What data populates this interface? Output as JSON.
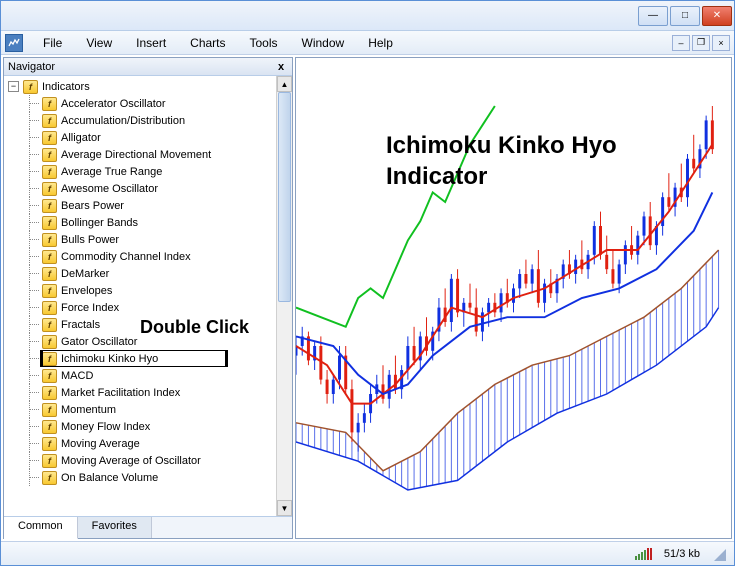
{
  "window": {
    "titlebar": {
      "minimize": "—",
      "maximize": "□",
      "close": "✕"
    }
  },
  "menubar": {
    "items": [
      "File",
      "View",
      "Insert",
      "Charts",
      "Tools",
      "Window",
      "Help"
    ],
    "child_min": "–",
    "child_restore": "❐",
    "child_close": "×"
  },
  "navigator": {
    "title": "Navigator",
    "close_glyph": "x",
    "root_label": "Indicators",
    "expand_glyph": "−",
    "icon_glyph": "f",
    "items": [
      "Accelerator Oscillator",
      "Accumulation/Distribution",
      "Alligator",
      "Average Directional Movement",
      "Average True Range",
      "Awesome Oscillator",
      "Bears Power",
      "Bollinger Bands",
      "Bulls Power",
      "Commodity Channel Index",
      "DeMarker",
      "Envelopes",
      "Force Index",
      "Fractals",
      "Gator Oscillator",
      "Ichimoku Kinko Hyo",
      "MACD",
      "Market Facilitation Index",
      "Momentum",
      "Money Flow Index",
      "Moving Average",
      "Moving Average of Oscillator",
      "On Balance Volume"
    ],
    "highlighted_index": 15,
    "tabs": {
      "common": "Common",
      "favorites": "Favorites"
    },
    "scroll": {
      "up": "▲",
      "down": "▼"
    }
  },
  "annotations": {
    "title_line1": "Ichimoku Kinko Hyo",
    "title_line2": "Indicator",
    "double_click": "Double Click"
  },
  "statusbar": {
    "transfer": "51/3 kb"
  },
  "chart_data": {
    "type": "candlestick-with-indicator",
    "indicator": "Ichimoku Kinko Hyo",
    "colors": {
      "up_candle": "#1030e0",
      "down_candle": "#e02010",
      "tenkan": "#e02010",
      "kijun": "#1030e0",
      "chikou": "#10c020",
      "span_a": "#a0522d",
      "span_b": "#1030e0",
      "cloud_hatch": "#1030e0"
    },
    "x_range": [
      0,
      70
    ],
    "y_range": [
      0,
      100
    ],
    "candles": [
      {
        "x": 0,
        "o": 38,
        "h": 42,
        "l": 34,
        "c": 40,
        "d": "u"
      },
      {
        "x": 1,
        "o": 40,
        "h": 44,
        "l": 38,
        "c": 42,
        "d": "u"
      },
      {
        "x": 2,
        "o": 42,
        "h": 43,
        "l": 36,
        "c": 37,
        "d": "d"
      },
      {
        "x": 3,
        "o": 37,
        "h": 41,
        "l": 35,
        "c": 40,
        "d": "u"
      },
      {
        "x": 4,
        "o": 40,
        "h": 42,
        "l": 32,
        "c": 33,
        "d": "d"
      },
      {
        "x": 5,
        "o": 33,
        "h": 35,
        "l": 28,
        "c": 30,
        "d": "d"
      },
      {
        "x": 6,
        "o": 30,
        "h": 34,
        "l": 28,
        "c": 33,
        "d": "u"
      },
      {
        "x": 7,
        "o": 33,
        "h": 40,
        "l": 31,
        "c": 38,
        "d": "u"
      },
      {
        "x": 8,
        "o": 38,
        "h": 40,
        "l": 30,
        "c": 31,
        "d": "d"
      },
      {
        "x": 9,
        "o": 31,
        "h": 33,
        "l": 20,
        "c": 22,
        "d": "d"
      },
      {
        "x": 10,
        "o": 22,
        "h": 26,
        "l": 18,
        "c": 24,
        "d": "u"
      },
      {
        "x": 11,
        "o": 24,
        "h": 28,
        "l": 22,
        "c": 26,
        "d": "u"
      },
      {
        "x": 12,
        "o": 26,
        "h": 32,
        "l": 24,
        "c": 30,
        "d": "u"
      },
      {
        "x": 13,
        "o": 30,
        "h": 34,
        "l": 28,
        "c": 32,
        "d": "u"
      },
      {
        "x": 14,
        "o": 32,
        "h": 36,
        "l": 28,
        "c": 29,
        "d": "d"
      },
      {
        "x": 15,
        "o": 29,
        "h": 35,
        "l": 27,
        "c": 34,
        "d": "u"
      },
      {
        "x": 16,
        "o": 34,
        "h": 38,
        "l": 30,
        "c": 31,
        "d": "d"
      },
      {
        "x": 17,
        "o": 31,
        "h": 36,
        "l": 29,
        "c": 35,
        "d": "u"
      },
      {
        "x": 18,
        "o": 35,
        "h": 42,
        "l": 33,
        "c": 40,
        "d": "u"
      },
      {
        "x": 19,
        "o": 40,
        "h": 44,
        "l": 36,
        "c": 37,
        "d": "d"
      },
      {
        "x": 20,
        "o": 37,
        "h": 43,
        "l": 35,
        "c": 42,
        "d": "u"
      },
      {
        "x": 21,
        "o": 42,
        "h": 46,
        "l": 38,
        "c": 39,
        "d": "d"
      },
      {
        "x": 22,
        "o": 39,
        "h": 44,
        "l": 37,
        "c": 43,
        "d": "u"
      },
      {
        "x": 23,
        "o": 43,
        "h": 50,
        "l": 41,
        "c": 48,
        "d": "u"
      },
      {
        "x": 24,
        "o": 48,
        "h": 52,
        "l": 44,
        "c": 45,
        "d": "d"
      },
      {
        "x": 25,
        "o": 45,
        "h": 55,
        "l": 43,
        "c": 54,
        "d": "u"
      },
      {
        "x": 26,
        "o": 54,
        "h": 56,
        "l": 46,
        "c": 47,
        "d": "d"
      },
      {
        "x": 27,
        "o": 47,
        "h": 50,
        "l": 44,
        "c": 49,
        "d": "u"
      },
      {
        "x": 28,
        "o": 49,
        "h": 53,
        "l": 47,
        "c": 48,
        "d": "d"
      },
      {
        "x": 29,
        "o": 48,
        "h": 52,
        "l": 42,
        "c": 43,
        "d": "d"
      },
      {
        "x": 30,
        "o": 43,
        "h": 48,
        "l": 41,
        "c": 47,
        "d": "u"
      },
      {
        "x": 31,
        "o": 47,
        "h": 50,
        "l": 44,
        "c": 49,
        "d": "u"
      },
      {
        "x": 32,
        "o": 49,
        "h": 51,
        "l": 46,
        "c": 47,
        "d": "d"
      },
      {
        "x": 33,
        "o": 47,
        "h": 52,
        "l": 45,
        "c": 51,
        "d": "u"
      },
      {
        "x": 34,
        "o": 51,
        "h": 54,
        "l": 48,
        "c": 49,
        "d": "d"
      },
      {
        "x": 35,
        "o": 49,
        "h": 53,
        "l": 47,
        "c": 52,
        "d": "u"
      },
      {
        "x": 36,
        "o": 52,
        "h": 56,
        "l": 50,
        "c": 55,
        "d": "u"
      },
      {
        "x": 37,
        "o": 55,
        "h": 58,
        "l": 52,
        "c": 53,
        "d": "d"
      },
      {
        "x": 38,
        "o": 53,
        "h": 57,
        "l": 51,
        "c": 56,
        "d": "u"
      },
      {
        "x": 39,
        "o": 56,
        "h": 60,
        "l": 48,
        "c": 49,
        "d": "d"
      },
      {
        "x": 40,
        "o": 49,
        "h": 54,
        "l": 47,
        "c": 53,
        "d": "u"
      },
      {
        "x": 41,
        "o": 53,
        "h": 56,
        "l": 50,
        "c": 51,
        "d": "d"
      },
      {
        "x": 42,
        "o": 51,
        "h": 55,
        "l": 49,
        "c": 54,
        "d": "u"
      },
      {
        "x": 43,
        "o": 54,
        "h": 58,
        "l": 52,
        "c": 57,
        "d": "u"
      },
      {
        "x": 44,
        "o": 57,
        "h": 60,
        "l": 54,
        "c": 55,
        "d": "d"
      },
      {
        "x": 45,
        "o": 55,
        "h": 59,
        "l": 53,
        "c": 58,
        "d": "u"
      },
      {
        "x": 46,
        "o": 58,
        "h": 62,
        "l": 55,
        "c": 56,
        "d": "d"
      },
      {
        "x": 47,
        "o": 56,
        "h": 60,
        "l": 54,
        "c": 59,
        "d": "u"
      },
      {
        "x": 48,
        "o": 59,
        "h": 66,
        "l": 57,
        "c": 65,
        "d": "u"
      },
      {
        "x": 49,
        "o": 65,
        "h": 68,
        "l": 58,
        "c": 59,
        "d": "d"
      },
      {
        "x": 50,
        "o": 59,
        "h": 63,
        "l": 55,
        "c": 56,
        "d": "d"
      },
      {
        "x": 51,
        "o": 56,
        "h": 60,
        "l": 52,
        "c": 53,
        "d": "d"
      },
      {
        "x": 52,
        "o": 53,
        "h": 58,
        "l": 51,
        "c": 57,
        "d": "u"
      },
      {
        "x": 53,
        "o": 57,
        "h": 62,
        "l": 55,
        "c": 61,
        "d": "u"
      },
      {
        "x": 54,
        "o": 61,
        "h": 65,
        "l": 58,
        "c": 59,
        "d": "d"
      },
      {
        "x": 55,
        "o": 59,
        "h": 64,
        "l": 57,
        "c": 63,
        "d": "u"
      },
      {
        "x": 56,
        "o": 63,
        "h": 68,
        "l": 61,
        "c": 67,
        "d": "u"
      },
      {
        "x": 57,
        "o": 67,
        "h": 70,
        "l": 60,
        "c": 61,
        "d": "d"
      },
      {
        "x": 58,
        "o": 61,
        "h": 66,
        "l": 59,
        "c": 65,
        "d": "u"
      },
      {
        "x": 59,
        "o": 65,
        "h": 72,
        "l": 63,
        "c": 71,
        "d": "u"
      },
      {
        "x": 60,
        "o": 71,
        "h": 76,
        "l": 68,
        "c": 69,
        "d": "d"
      },
      {
        "x": 61,
        "o": 69,
        "h": 74,
        "l": 67,
        "c": 73,
        "d": "u"
      },
      {
        "x": 62,
        "o": 73,
        "h": 78,
        "l": 70,
        "c": 71,
        "d": "d"
      },
      {
        "x": 63,
        "o": 71,
        "h": 80,
        "l": 69,
        "c": 79,
        "d": "u"
      },
      {
        "x": 64,
        "o": 79,
        "h": 84,
        "l": 76,
        "c": 77,
        "d": "d"
      },
      {
        "x": 65,
        "o": 77,
        "h": 82,
        "l": 75,
        "c": 81,
        "d": "u"
      },
      {
        "x": 66,
        "o": 81,
        "h": 88,
        "l": 79,
        "c": 87,
        "d": "u"
      },
      {
        "x": 67,
        "o": 87,
        "h": 90,
        "l": 80,
        "c": 81,
        "d": "d"
      }
    ],
    "tenkan": [
      [
        0,
        40
      ],
      [
        5,
        36
      ],
      [
        9,
        28
      ],
      [
        12,
        28
      ],
      [
        16,
        32
      ],
      [
        20,
        38
      ],
      [
        25,
        48
      ],
      [
        30,
        46
      ],
      [
        35,
        50
      ],
      [
        40,
        52
      ],
      [
        45,
        56
      ],
      [
        50,
        60
      ],
      [
        55,
        60
      ],
      [
        60,
        68
      ],
      [
        65,
        78
      ],
      [
        67,
        82
      ]
    ],
    "kijun": [
      [
        0,
        42
      ],
      [
        6,
        40
      ],
      [
        10,
        34
      ],
      [
        14,
        30
      ],
      [
        18,
        32
      ],
      [
        22,
        38
      ],
      [
        28,
        44
      ],
      [
        34,
        46
      ],
      [
        40,
        46
      ],
      [
        46,
        50
      ],
      [
        52,
        52
      ],
      [
        58,
        56
      ],
      [
        64,
        64
      ],
      [
        67,
        72
      ]
    ],
    "chikou": [
      [
        0,
        48
      ],
      [
        4,
        46
      ],
      [
        8,
        44
      ],
      [
        10,
        50
      ],
      [
        12,
        52
      ],
      [
        14,
        50
      ],
      [
        16,
        56
      ],
      [
        18,
        62
      ],
      [
        20,
        66
      ],
      [
        22,
        72
      ],
      [
        24,
        70
      ],
      [
        26,
        76
      ],
      [
        28,
        82
      ],
      [
        30,
        86
      ],
      [
        32,
        90
      ]
    ],
    "span_a": [
      [
        0,
        24
      ],
      [
        8,
        22
      ],
      [
        14,
        14
      ],
      [
        20,
        18
      ],
      [
        26,
        26
      ],
      [
        32,
        32
      ],
      [
        38,
        36
      ],
      [
        44,
        38
      ],
      [
        50,
        42
      ],
      [
        56,
        46
      ],
      [
        62,
        52
      ],
      [
        68,
        60
      ]
    ],
    "span_b": [
      [
        0,
        20
      ],
      [
        10,
        16
      ],
      [
        18,
        10
      ],
      [
        26,
        12
      ],
      [
        34,
        20
      ],
      [
        42,
        26
      ],
      [
        50,
        30
      ],
      [
        58,
        36
      ],
      [
        66,
        44
      ],
      [
        68,
        48
      ]
    ]
  }
}
